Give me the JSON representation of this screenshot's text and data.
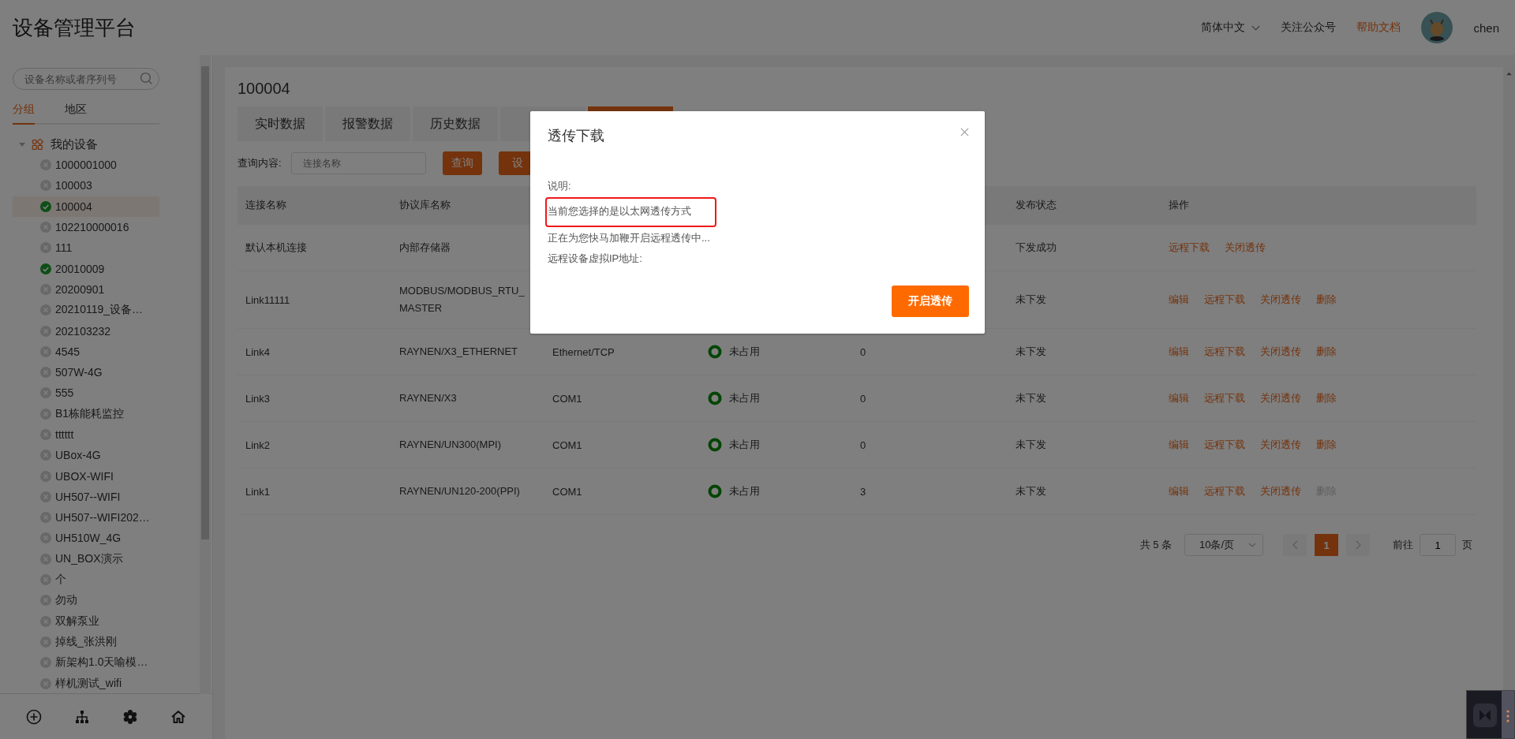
{
  "header": {
    "title": "设备管理平台",
    "language": "简体中文",
    "links": [
      {
        "label": "关注公众号",
        "highlight": false
      },
      {
        "label": "帮助文档",
        "highlight": true
      }
    ],
    "user": "chen"
  },
  "sidebar": {
    "search": {
      "placeholder": "设备名称或者序列号"
    },
    "tabs": [
      {
        "label": "分组",
        "selected": true
      },
      {
        "label": "地区",
        "selected": false
      }
    ],
    "tree": {
      "label": "我的设备",
      "expanded": true,
      "children": [
        {
          "label": "1000001000",
          "online": false,
          "selected": false
        },
        {
          "label": "100003",
          "online": false,
          "selected": false
        },
        {
          "label": "100004",
          "online": true,
          "selected": true
        },
        {
          "label": "102210000016",
          "online": false,
          "selected": false
        },
        {
          "label": "111",
          "online": false,
          "selected": false
        },
        {
          "label": "20010009",
          "online": true,
          "selected": false
        },
        {
          "label": "20200901",
          "online": false,
          "selected": false
        },
        {
          "label": "20210119_设备…",
          "online": false,
          "selected": false
        },
        {
          "label": "202103232",
          "online": false,
          "selected": false
        },
        {
          "label": "4545",
          "online": false,
          "selected": false
        },
        {
          "label": "507W-4G",
          "online": false,
          "selected": false
        },
        {
          "label": "555",
          "online": false,
          "selected": false
        },
        {
          "label": "B1栋能耗监控",
          "online": false,
          "selected": false
        },
        {
          "label": "tttttt",
          "online": false,
          "selected": false
        },
        {
          "label": "UBox-4G",
          "online": false,
          "selected": false
        },
        {
          "label": "UBOX-WIFI",
          "online": false,
          "selected": false
        },
        {
          "label": "UH507--WIFI",
          "online": false,
          "selected": false
        },
        {
          "label": "UH507--WIFI202…",
          "online": false,
          "selected": false
        },
        {
          "label": "UH510W_4G",
          "online": false,
          "selected": false
        },
        {
          "label": "UN_BOX演示",
          "online": false,
          "selected": false
        },
        {
          "label": "个",
          "online": false,
          "selected": false
        },
        {
          "label": "勿动",
          "online": false,
          "selected": false
        },
        {
          "label": "双解泵业",
          "online": false,
          "selected": false
        },
        {
          "label": "掉线_张洪刚",
          "online": false,
          "selected": false
        },
        {
          "label": "新架构1.0天喻模…",
          "online": false,
          "selected": false
        },
        {
          "label": "样机测试_wifi",
          "online": false,
          "selected": false
        }
      ]
    }
  },
  "main": {
    "device_title": "100004",
    "tabs": [
      {
        "label": "实时数据",
        "selected": false
      },
      {
        "label": "报警数据",
        "selected": false
      },
      {
        "label": "历史数据",
        "selected": false
      },
      {
        "selected": false
      },
      {
        "selected": true
      }
    ],
    "query": {
      "label": "查询内容:",
      "placeholder": "连接名称",
      "buttons": [
        "查询",
        "设"
      ]
    },
    "table": {
      "columns": [
        "连接名称",
        "协议库名称",
        "发布状态",
        "操作"
      ],
      "rows": [
        {
          "name": "默认本机连接",
          "protocol": "内部存储器",
          "publish": "下发成功",
          "actions": [
            {
              "label": "远程下载",
              "disabled": false
            },
            {
              "label": "关闭透传",
              "disabled": false
            }
          ]
        },
        {
          "name": "Link11111",
          "protocol": "MODBUS/MODBUS_RTU_MASTER",
          "publish": "未下发",
          "actions": [
            {
              "label": "编辑",
              "disabled": false
            },
            {
              "label": "远程下载",
              "disabled": false
            },
            {
              "label": "关闭透传",
              "disabled": false
            },
            {
              "label": "删除",
              "disabled": false
            }
          ]
        },
        {
          "name": "Link4",
          "protocol": "RAYNEN/X3_ETHERNET",
          "port": "Ethernet/TCP",
          "status": {
            "text": "未占用",
            "occupied": false
          },
          "count": "0",
          "publish": "未下发",
          "actions": [
            {
              "label": "编辑",
              "disabled": false
            },
            {
              "label": "远程下载",
              "disabled": false
            },
            {
              "label": "关闭透传",
              "disabled": false
            },
            {
              "label": "删除",
              "disabled": false
            }
          ]
        },
        {
          "name": "Link3",
          "protocol": "RAYNEN/X3",
          "port": "COM1",
          "status": {
            "text": "未占用",
            "occupied": false
          },
          "count": "0",
          "publish": "未下发",
          "actions": [
            {
              "label": "编辑",
              "disabled": false
            },
            {
              "label": "远程下载",
              "disabled": false
            },
            {
              "label": "关闭透传",
              "disabled": false
            },
            {
              "label": "删除",
              "disabled": false
            }
          ]
        },
        {
          "name": "Link2",
          "protocol": "RAYNEN/UN300(MPI)",
          "port": "COM1",
          "status": {
            "text": "未占用",
            "occupied": false
          },
          "count": "0",
          "publish": "未下发",
          "actions": [
            {
              "label": "编辑",
              "disabled": false
            },
            {
              "label": "远程下载",
              "disabled": false
            },
            {
              "label": "关闭透传",
              "disabled": false
            },
            {
              "label": "删除",
              "disabled": false
            }
          ]
        },
        {
          "name": "Link1",
          "protocol": "RAYNEN/UN120-200(PPI)",
          "port": "COM1",
          "status": {
            "text": "未占用",
            "occupied": false
          },
          "count": "3",
          "publish": "未下发",
          "actions": [
            {
              "label": "编辑",
              "disabled": false
            },
            {
              "label": "远程下载",
              "disabled": false
            },
            {
              "label": "关闭透传",
              "disabled": false
            },
            {
              "label": "删除",
              "disabled": true
            }
          ]
        }
      ]
    },
    "pagination": {
      "total": "共 5 条",
      "page_size": "10条/页",
      "pages": [
        {
          "label": "1",
          "selected": true
        }
      ],
      "goto_label": "前往",
      "goto_value": "1",
      "page_suffix": "页"
    }
  },
  "dialog": {
    "title": "透传下载",
    "lines": [
      {
        "text": "说明:",
        "highlighted": false
      },
      {
        "text": "当前您选择的是以太网透传方式",
        "highlighted": true
      },
      {
        "text": "正在为您快马加鞭开启远程透传中...",
        "highlighted": false
      },
      {
        "text": "远程设备虚拟IP地址:",
        "highlighted": false
      }
    ],
    "button": "开启透传"
  }
}
